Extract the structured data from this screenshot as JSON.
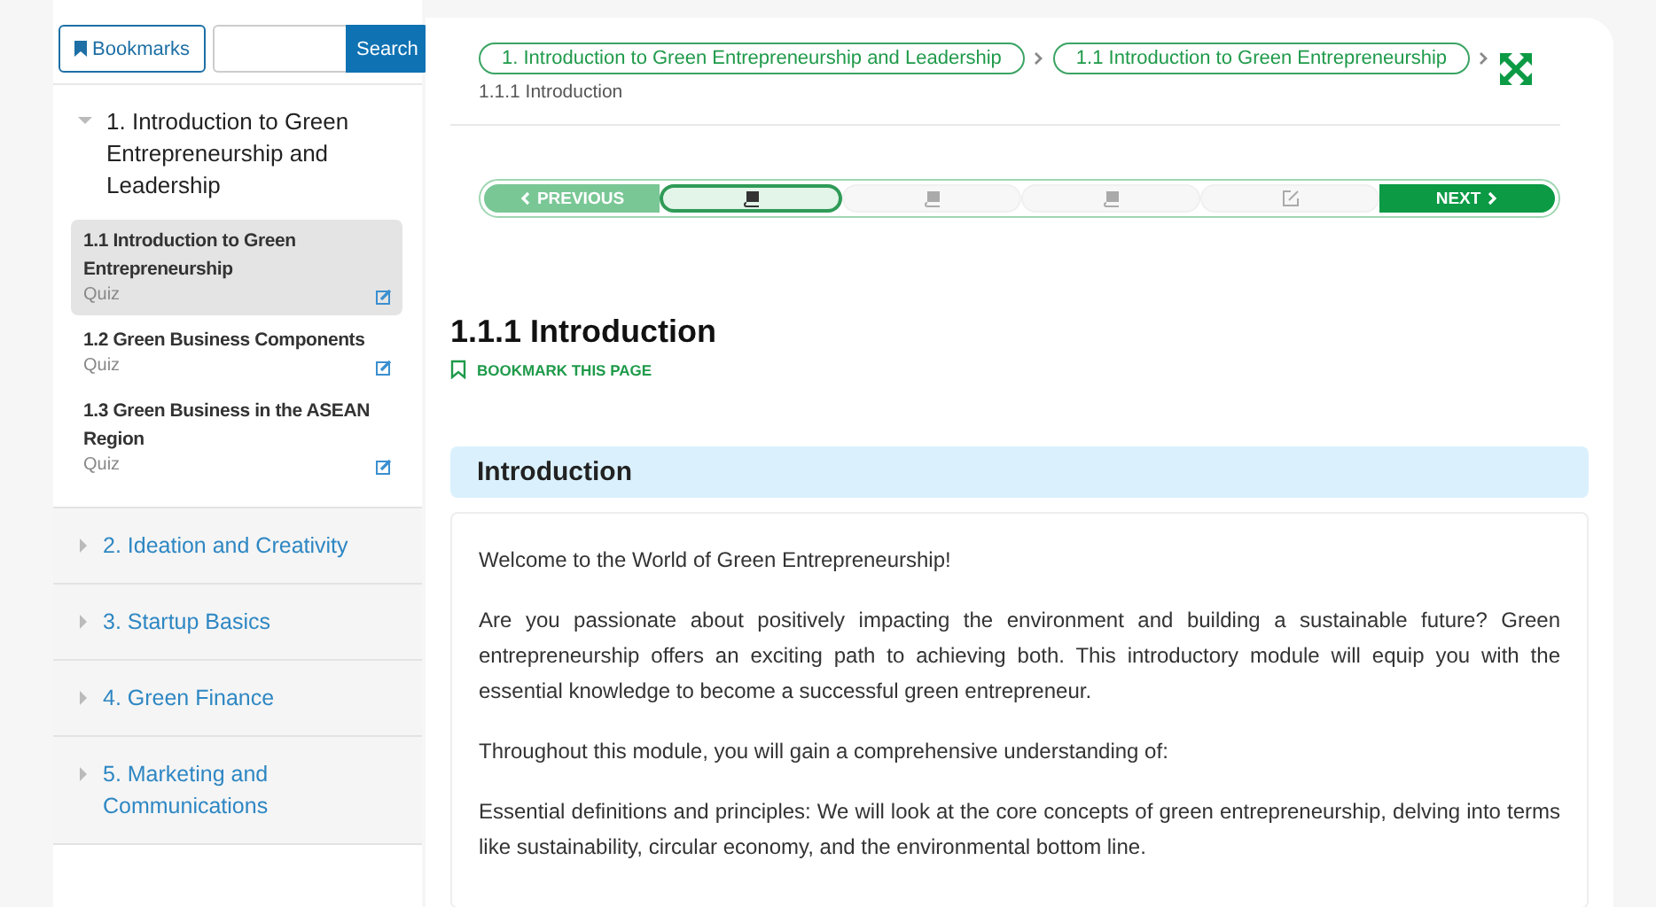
{
  "sidebar": {
    "bookmarks_button": "Bookmarks",
    "search": {
      "button": "Search"
    },
    "chapters": [
      {
        "title": "1. Introduction to Green Entrepreneurship and Leadership",
        "expanded": true,
        "lessons": [
          {
            "title": "1.1 Introduction to Green Entrepreneurship",
            "type": "Quiz",
            "selected": true
          },
          {
            "title": "1.2 Green Business Components",
            "type": "Quiz",
            "selected": false
          },
          {
            "title": "1.3 Green Business in the ASEAN Region",
            "type": "Quiz",
            "selected": false
          }
        ]
      },
      {
        "title": "2. Ideation and Creativity",
        "expanded": false
      },
      {
        "title": "3. Startup Basics",
        "expanded": false
      },
      {
        "title": "4. Green Finance",
        "expanded": false
      },
      {
        "title": "5. Marketing and Communications",
        "expanded": false
      }
    ]
  },
  "breadcrumb": {
    "items": [
      "1. Introduction to Green Entrepreneurship and Leadership",
      "1.1 Introduction to Green Entrepreneurship"
    ],
    "current": "1.1.1 Introduction"
  },
  "steps": [
    {
      "kind": "previous",
      "label": "PREVIOUS",
      "selected": false
    },
    {
      "kind": "page",
      "selected": true
    },
    {
      "kind": "page",
      "selected": false
    },
    {
      "kind": "page",
      "selected": false
    },
    {
      "kind": "quiz",
      "selected": false
    },
    {
      "kind": "next",
      "label": "NEXT",
      "selected": false
    }
  ],
  "page": {
    "title": "1.1.1 Introduction",
    "bookmark": "BOOKMARK THIS PAGE",
    "section": "Introduction",
    "paragraphs": [
      "Welcome to the World of Green Entrepreneurship!",
      "Are you passionate about positively impacting the environment and building a sustainable future? Green entrepreneurship offers an exciting path to achieving both. This introductory module will equip you with the essential knowledge to become a successful green entrepreneur.",
      "Throughout this module, you will gain a comprehensive understanding of:",
      "Essential definitions and principles: We will look at the core concepts of green entrepreneurship, delving into terms like sustainability, circular economy, and the environmental bottom line."
    ]
  }
}
